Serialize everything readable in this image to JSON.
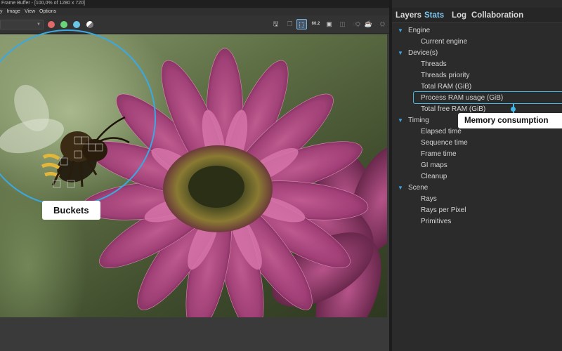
{
  "window": {
    "title": "Frame Buffer - [100,0% of 1280 x 720]"
  },
  "menu": {
    "items": [
      {
        "label": "y"
      },
      {
        "label": "Image"
      },
      {
        "label": "View"
      },
      {
        "label": "Options"
      }
    ]
  },
  "toolbar": {
    "channel_value": "",
    "channels": [
      {
        "name": "red-channel-icon",
        "color": "#e06a6a"
      },
      {
        "name": "green-channel-icon",
        "color": "#6ad47a"
      },
      {
        "name": "blue-channel-icon",
        "color": "#6ac4e6"
      },
      {
        "name": "alpha-channel-icon",
        "color": "#ffffff"
      }
    ],
    "tool_icons": [
      {
        "name": "save-icon",
        "glyph": "🖫",
        "state": "normal"
      },
      {
        "name": "copy-icon",
        "glyph": "❐",
        "state": "dim"
      },
      {
        "name": "region-select-icon",
        "glyph": "⬚",
        "state": "active"
      },
      {
        "name": "gi-icon",
        "glyph": "60.2",
        "state": "normal"
      },
      {
        "name": "display-icon",
        "glyph": "▣",
        "state": "normal"
      },
      {
        "name": "compare-icon",
        "glyph": "◫",
        "state": "dim"
      },
      {
        "name": "denoise-icon",
        "glyph": "◌",
        "state": "dim"
      },
      {
        "name": "teapot-icon",
        "glyph": "⛭",
        "state": "dim"
      },
      {
        "name": "teapot-render-icon",
        "glyph": "☕",
        "state": "normal"
      },
      {
        "name": "teapot-stop-icon",
        "glyph": "⛭",
        "state": "dim"
      }
    ]
  },
  "panel": {
    "tabs": [
      {
        "label": "Layers",
        "active": false
      },
      {
        "label": "Stats",
        "active": true
      },
      {
        "label": "Log",
        "active": false
      },
      {
        "label": "Collaboration",
        "active": false
      }
    ],
    "tree": {
      "engine": {
        "label": "Engine",
        "items": [
          "Current engine"
        ]
      },
      "devices": {
        "label": "Device(s)",
        "items": [
          "Threads",
          "Threads priority",
          "Total RAM (GiB)",
          "Process RAM usage (GiB)",
          "Total free RAM (GiB)"
        ]
      },
      "timing": {
        "label": "Timing",
        "items": [
          "Elapsed time",
          "Sequence time",
          "Frame time",
          "GI maps",
          "Cleanup"
        ]
      },
      "scene": {
        "label": "Scene",
        "items": [
          "Rays",
          "Rays per Pixel",
          "Primitives"
        ]
      }
    }
  },
  "annotations": {
    "memory": "Memory consumption",
    "buckets": "Buckets",
    "accent_color": "#3aa9e2"
  },
  "colors": {
    "panel_bg": "#2b2b2b",
    "active_tab": "#7cc6f0",
    "tree_arrow": "#3fa4dc"
  }
}
